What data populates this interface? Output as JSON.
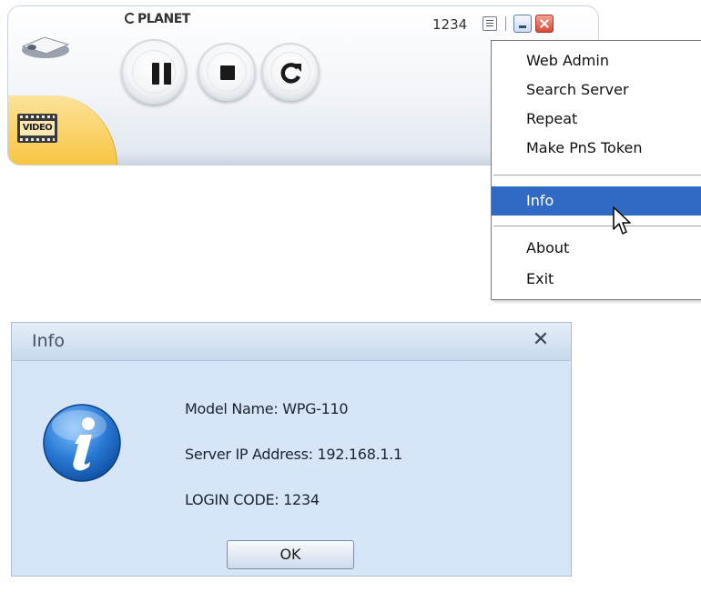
{
  "player": {
    "brand": "PLANET",
    "video_tab_label": "VIDEO",
    "login_code": "1234",
    "controls": [
      "pause",
      "stop",
      "repeat"
    ]
  },
  "context_menu": {
    "items": [
      {
        "label": "Web Admin"
      },
      {
        "label": "Search Server"
      },
      {
        "label": "Repeat"
      },
      {
        "label": "Make PnS Token"
      },
      {
        "label": "Info",
        "highlighted": true
      },
      {
        "label": "About"
      },
      {
        "label": "Exit"
      }
    ],
    "highlight_color": "#316ac5"
  },
  "dialog": {
    "title": "Info",
    "close_glyph": "✕",
    "lines": [
      "Model Name: WPG-110",
      "Server IP Address: 192.168.1.1",
      "LOGIN CODE: 1234"
    ],
    "ok_label": "OK",
    "icon": "info-icon"
  }
}
